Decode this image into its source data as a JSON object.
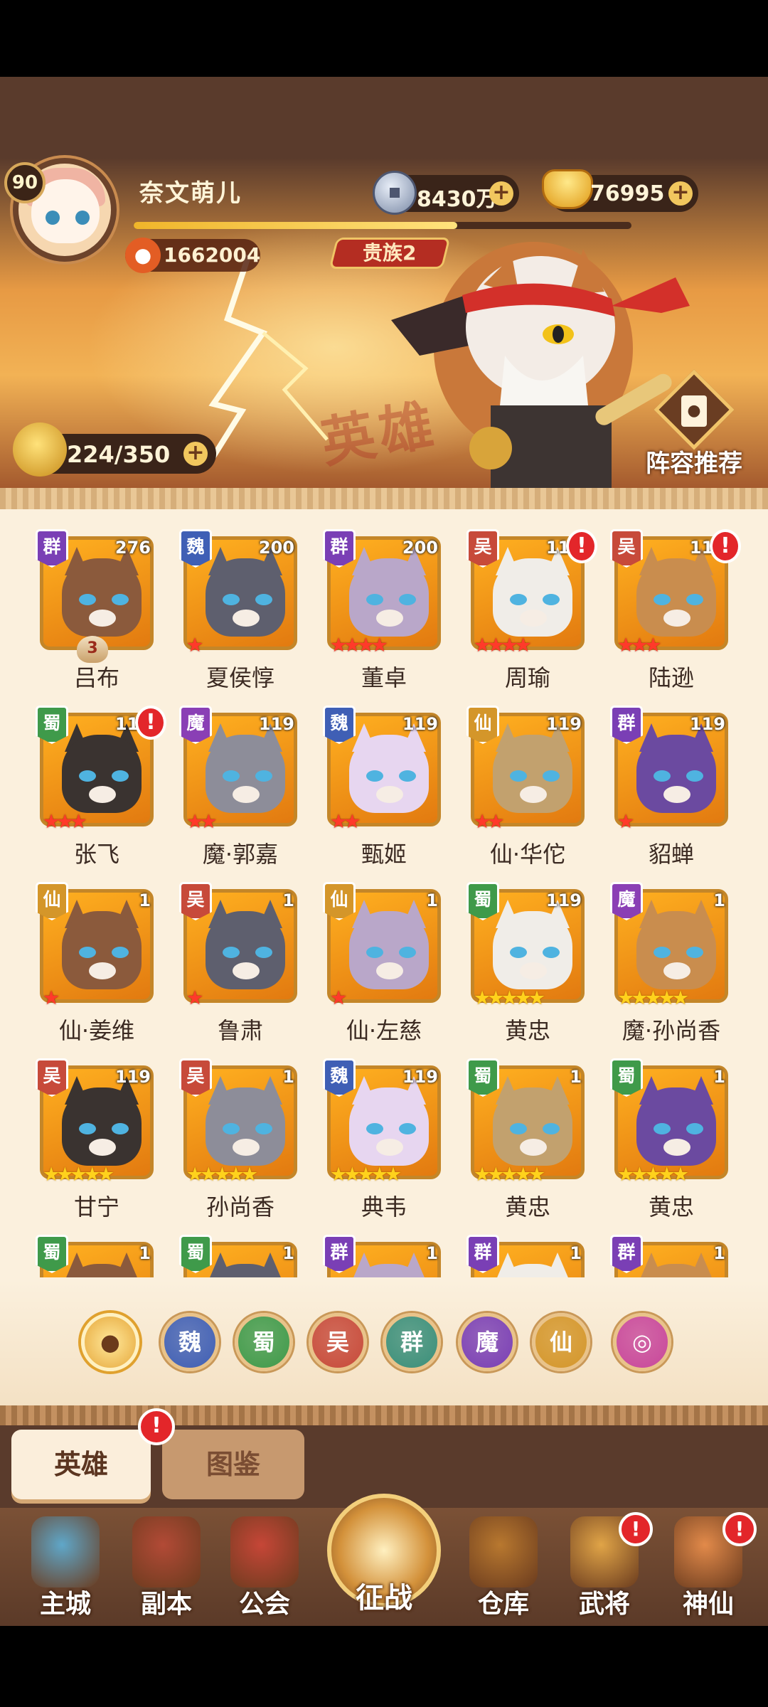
{
  "player": {
    "level": "90",
    "name": "奈文萌儿",
    "power": "1662004",
    "vip": "贵族2",
    "exp_fraction": 0.65
  },
  "resources": {
    "coins": "8430万",
    "gold": "76995",
    "stamina": "224/350"
  },
  "header": {
    "recommend_label": "阵容推荐",
    "watermark": "英雄"
  },
  "heroes": [
    {
      "name": "吕布",
      "faction": "群",
      "level": "276",
      "stars": 0,
      "star_color": "red",
      "alert": false,
      "badge": "3",
      "color": "#7a3fb5"
    },
    {
      "name": "夏侯惇",
      "faction": "魏",
      "level": "200",
      "stars": 1,
      "star_color": "red",
      "alert": false,
      "color": "#3f5fb5"
    },
    {
      "name": "董卓",
      "faction": "群",
      "level": "200",
      "stars": 4,
      "star_color": "red",
      "alert": false,
      "color": "#7a3fb5"
    },
    {
      "name": "周瑜",
      "faction": "吴",
      "level": "119",
      "stars": 4,
      "star_color": "red",
      "alert": true,
      "color": "#c74a3a"
    },
    {
      "name": "陆逊",
      "faction": "吴",
      "level": "119",
      "stars": 3,
      "star_color": "red",
      "alert": true,
      "color": "#c74a3a"
    },
    {
      "name": "张飞",
      "faction": "蜀",
      "level": "119",
      "stars": 3,
      "star_color": "red",
      "alert": true,
      "color": "#3f9a4a"
    },
    {
      "name": "魔·郭嘉",
      "faction": "魔",
      "level": "119",
      "stars": 2,
      "star_color": "red",
      "alert": false,
      "color": "#8a3fb5"
    },
    {
      "name": "甄姬",
      "faction": "魏",
      "level": "119",
      "stars": 2,
      "star_color": "red",
      "alert": false,
      "color": "#3f5fb5"
    },
    {
      "name": "仙·华佗",
      "faction": "仙",
      "level": "119",
      "stars": 2,
      "star_color": "red",
      "alert": false,
      "color": "#d4962a"
    },
    {
      "name": "貂蝉",
      "faction": "群",
      "level": "119",
      "stars": 1,
      "star_color": "red",
      "alert": false,
      "color": "#7a3fb5"
    },
    {
      "name": "仙·姜维",
      "faction": "仙",
      "level": "1",
      "stars": 1,
      "star_color": "red",
      "alert": false,
      "color": "#d4962a"
    },
    {
      "name": "鲁肃",
      "faction": "吴",
      "level": "1",
      "stars": 1,
      "star_color": "red",
      "alert": false,
      "color": "#c74a3a"
    },
    {
      "name": "仙·左慈",
      "faction": "仙",
      "level": "1",
      "stars": 1,
      "star_color": "red",
      "alert": false,
      "color": "#d4962a"
    },
    {
      "name": "黄忠",
      "faction": "蜀",
      "level": "119",
      "stars": 5,
      "star_color": "gold",
      "alert": false,
      "color": "#3f9a4a"
    },
    {
      "name": "魔·孙尚香",
      "faction": "魔",
      "level": "1",
      "stars": 5,
      "star_color": "gold",
      "alert": false,
      "color": "#8a3fb5"
    },
    {
      "name": "甘宁",
      "faction": "吴",
      "level": "119",
      "stars": 5,
      "star_color": "gold",
      "alert": false,
      "color": "#c74a3a"
    },
    {
      "name": "孙尚香",
      "faction": "吴",
      "level": "1",
      "stars": 5,
      "star_color": "gold",
      "alert": false,
      "color": "#c74a3a"
    },
    {
      "name": "典韦",
      "faction": "魏",
      "level": "119",
      "stars": 5,
      "star_color": "gold",
      "alert": false,
      "color": "#3f5fb5"
    },
    {
      "name": "黄忠",
      "faction": "蜀",
      "level": "1",
      "stars": 5,
      "star_color": "gold",
      "alert": false,
      "color": "#3f9a4a"
    },
    {
      "name": "黄忠",
      "faction": "蜀",
      "level": "1",
      "stars": 5,
      "star_color": "gold",
      "alert": false,
      "color": "#3f9a4a"
    },
    {
      "name": "",
      "faction": "蜀",
      "level": "1",
      "stars": 0,
      "star_color": "gold",
      "alert": false,
      "color": "#3f9a4a"
    },
    {
      "name": "",
      "faction": "蜀",
      "level": "1",
      "stars": 0,
      "star_color": "gold",
      "alert": false,
      "color": "#3f9a4a"
    },
    {
      "name": "",
      "faction": "群",
      "level": "1",
      "stars": 0,
      "star_color": "gold",
      "alert": false,
      "color": "#7a3fb5"
    },
    {
      "name": "",
      "faction": "群",
      "level": "1",
      "stars": 0,
      "star_color": "gold",
      "alert": false,
      "color": "#7a3fb5"
    },
    {
      "name": "",
      "faction": "群",
      "level": "1",
      "stars": 0,
      "star_color": "gold",
      "alert": false,
      "color": "#7a3fb5"
    }
  ],
  "filters": [
    {
      "label": "",
      "icon": "paw-icon",
      "color": "#d8962a"
    },
    {
      "label": "魏",
      "icon": "",
      "color": "#3f5fb5"
    },
    {
      "label": "蜀",
      "icon": "",
      "color": "#3f9a4a"
    },
    {
      "label": "吴",
      "icon": "",
      "color": "#c74a3a"
    },
    {
      "label": "群",
      "icon": "",
      "color": "#3a8f7a"
    },
    {
      "label": "魔",
      "icon": "",
      "color": "#7a3fb5"
    },
    {
      "label": "仙",
      "icon": "",
      "color": "#d4962a"
    },
    {
      "label": "",
      "icon": "swirl-icon",
      "color": "#c8479b"
    }
  ],
  "tabs": {
    "hero": "英雄",
    "atlas": "图鉴",
    "alert": "!"
  },
  "nav": [
    {
      "label": "主城",
      "icon": "castle-icon",
      "alert": false,
      "color": "#5fa7c9"
    },
    {
      "label": "副本",
      "icon": "sword-icon",
      "alert": false,
      "color": "#b24a36"
    },
    {
      "label": "公会",
      "icon": "flag-icon",
      "alert": false,
      "color": "#c64637"
    },
    {
      "label": "征战",
      "icon": "battle-icon",
      "alert": false,
      "color": "#d3913a"
    },
    {
      "label": "仓库",
      "icon": "bag-icon",
      "alert": false,
      "color": "#b8782f"
    },
    {
      "label": "武将",
      "icon": "general-icon",
      "alert": true,
      "color": "#e0a447"
    },
    {
      "label": "神仙",
      "icon": "cat-icon",
      "alert": true,
      "color": "#e28a4a"
    }
  ],
  "colors": {
    "accent": "#f1c75e",
    "alert": "#e3262a",
    "panel": "#5a3b2c"
  }
}
